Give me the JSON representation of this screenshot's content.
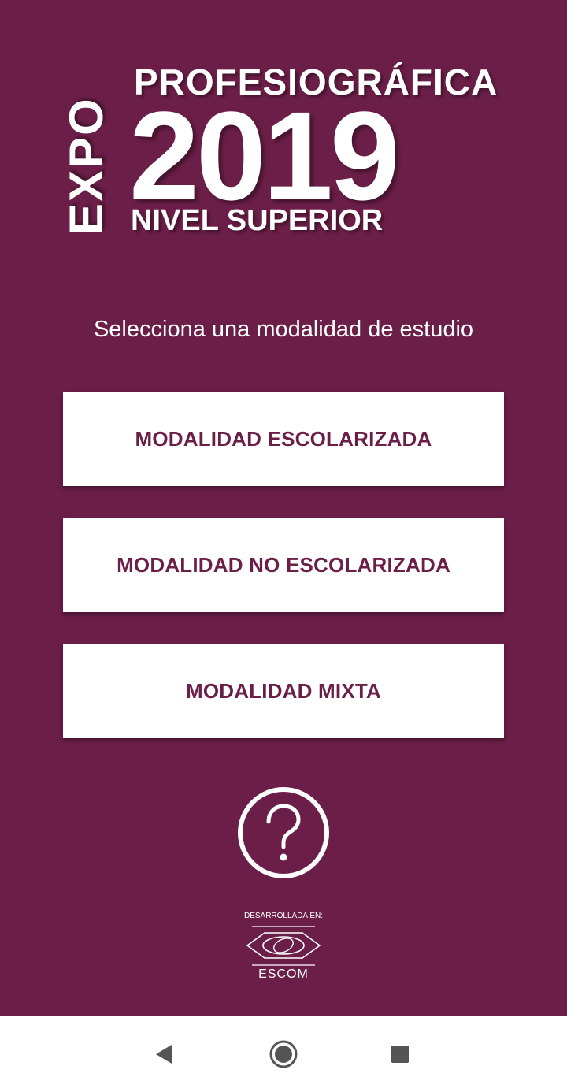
{
  "logo": {
    "expo": "EXPO",
    "title": "PROFESIOGRÁFICA",
    "year": "2019",
    "subtitle": "NIVEL SUPERIOR"
  },
  "prompt": "Selecciona una modalidad de estudio",
  "modes": [
    {
      "label": "MODALIDAD ESCOLARIZADA"
    },
    {
      "label": "MODALIDAD NO ESCOLARIZADA"
    },
    {
      "label": "MODALIDAD MIXTA"
    }
  ],
  "help": {
    "icon": "help-circle-icon"
  },
  "credit": {
    "developed_at": "DESARROLLADA EN:",
    "institution": "ESCOM"
  },
  "navbar": {
    "back_icon": "back-triangle-icon",
    "home_icon": "home-circle-icon",
    "recent_icon": "recent-square-icon"
  },
  "colors": {
    "background": "#6b1e47",
    "button_bg": "#ffffff",
    "button_text": "#6b1e47",
    "navbar_icons": "#555555"
  }
}
